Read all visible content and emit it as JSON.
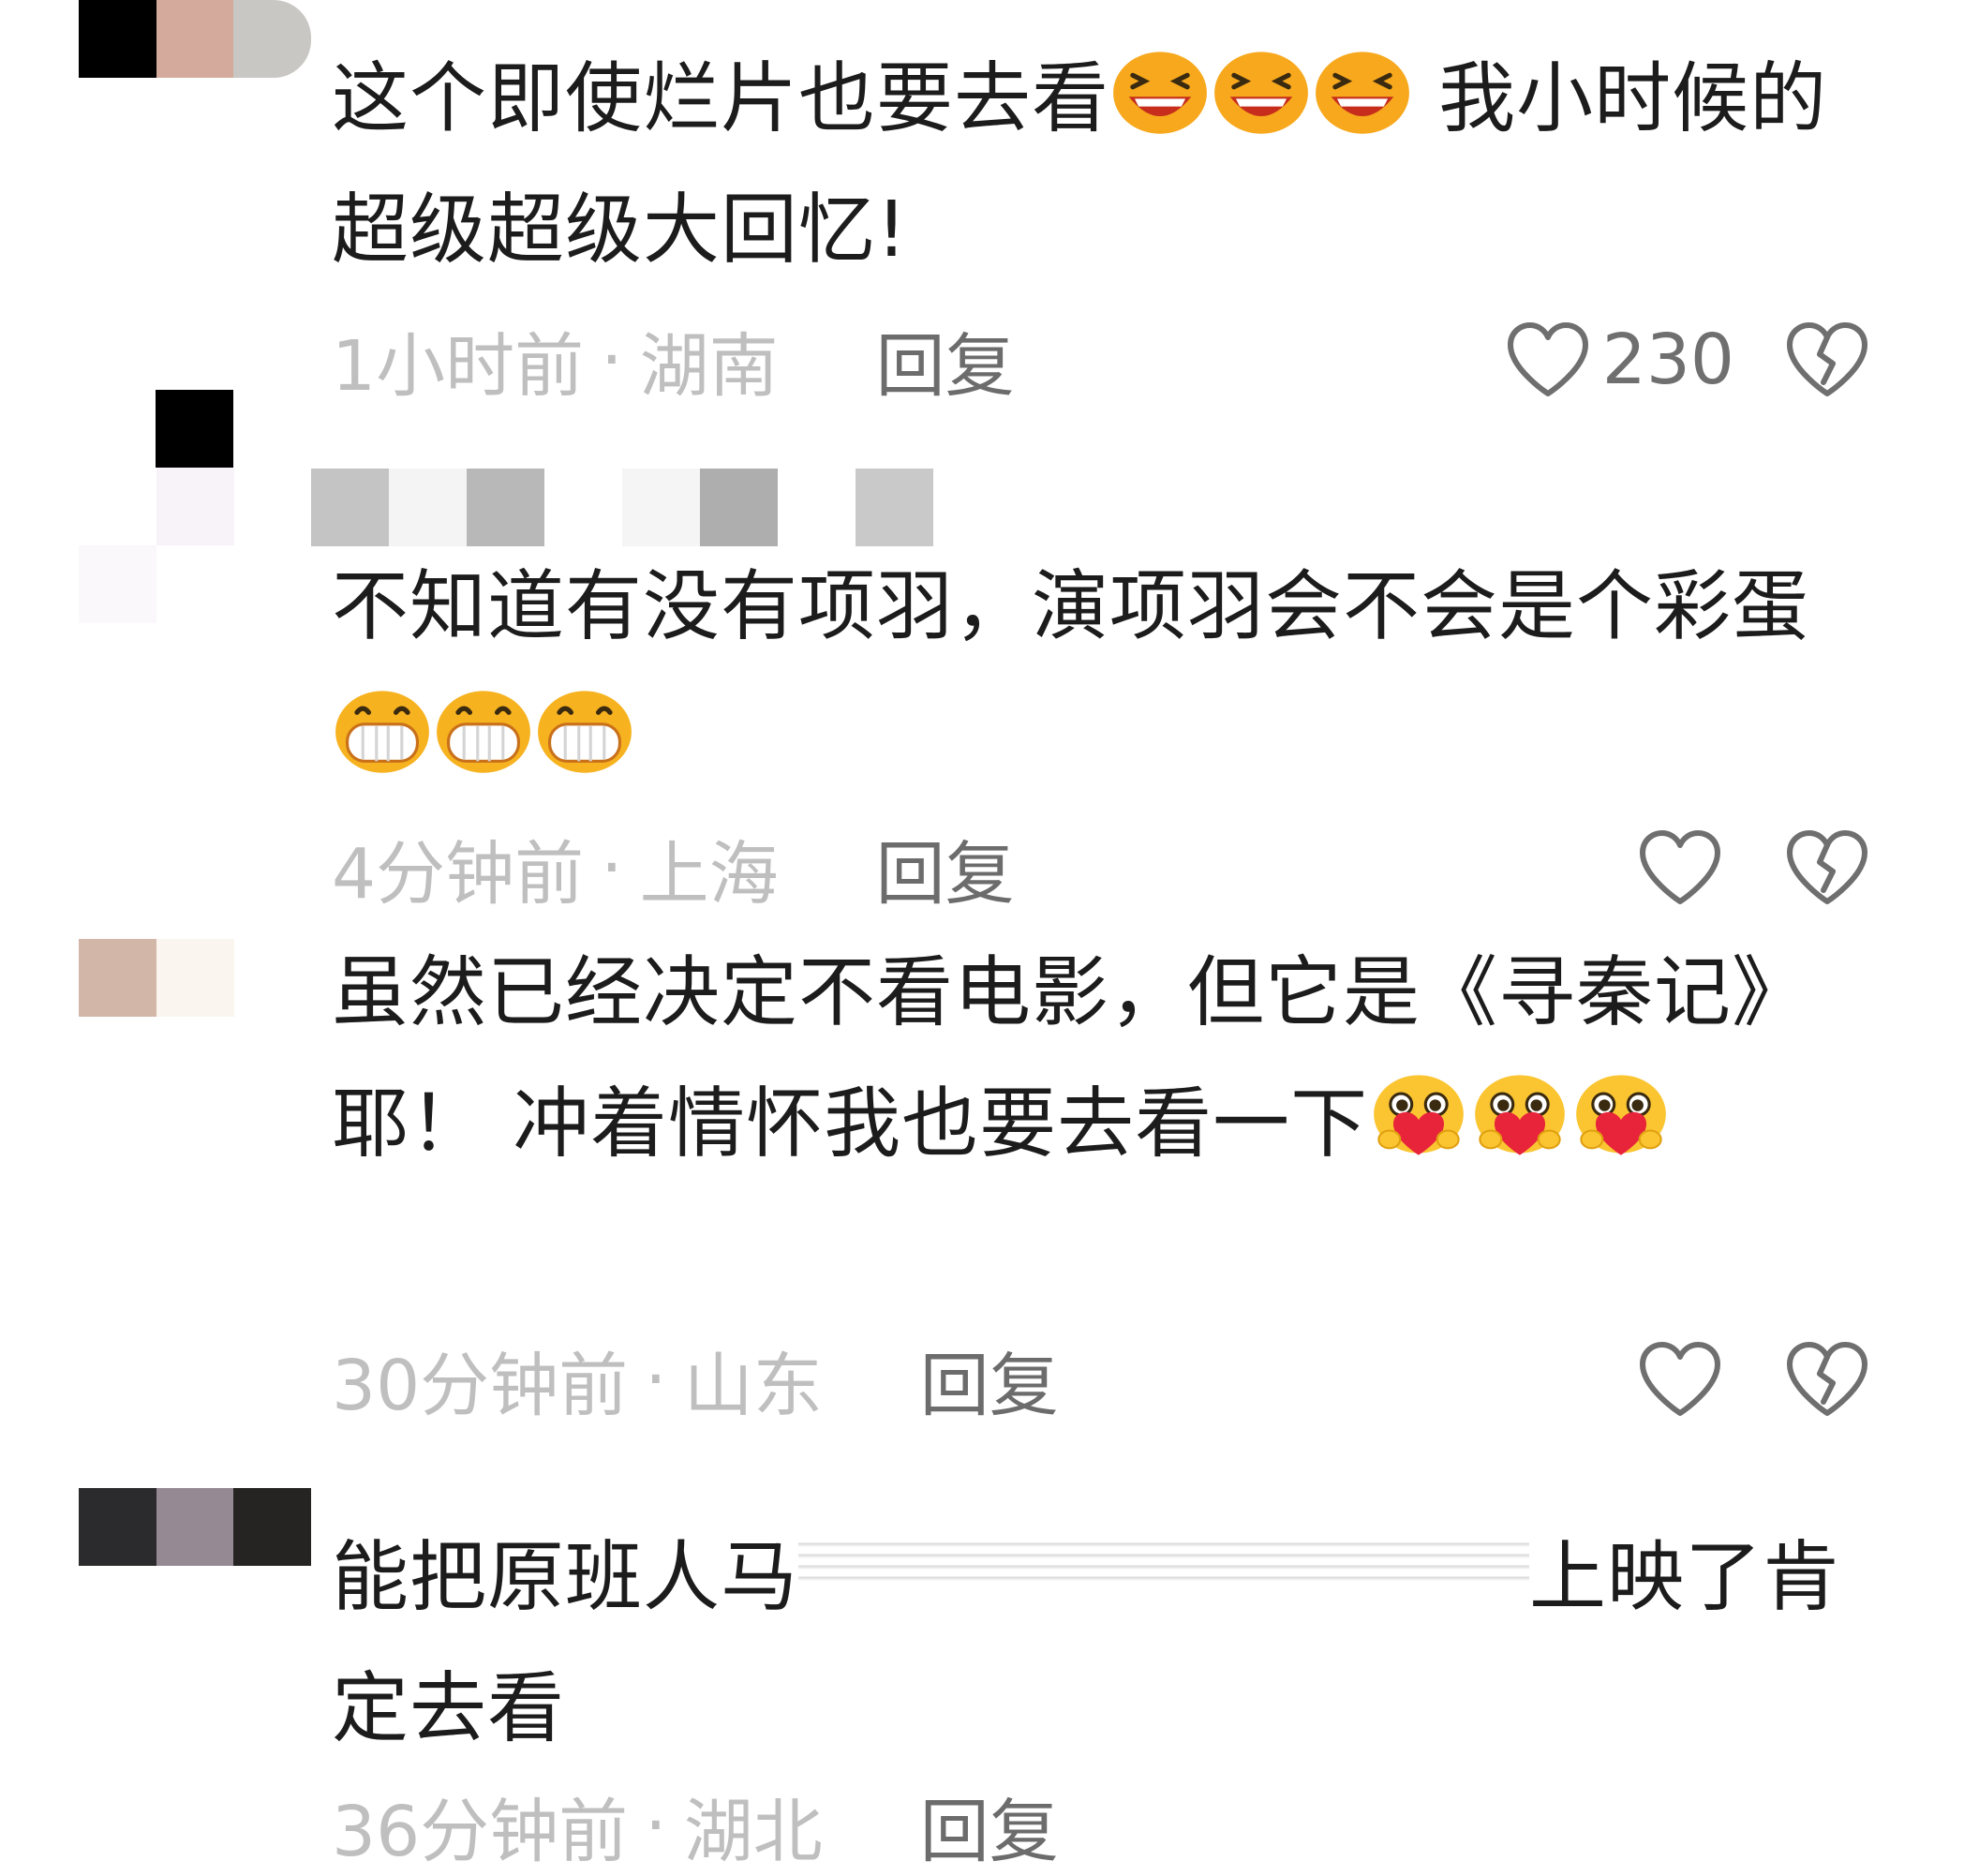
{
  "comments": [
    {
      "text_a": "这个即使烂片也要去看",
      "emoji_a": "laughing-face",
      "text_b": " 我小时候的超级超级大回忆!",
      "time": "1小时前",
      "location": "湖南",
      "reply_label": "回复",
      "likes": "230"
    },
    {
      "text_a": "不知道有没有项羽，演项羽会不会是个彩蛋",
      "emoji_a": "grinning-teeth-face",
      "time": "4分钟前",
      "location": "上海",
      "reply_label": "回复",
      "likes": ""
    },
    {
      "text_a": "虽然已经决定不看电影，但它是《寻秦记》耶！   冲着情怀我也要去看一下",
      "emoji_a": "heart-hug-face",
      "time": "30分钟前",
      "location": "山东",
      "reply_label": "回复",
      "likes": ""
    },
    {
      "text_a": "能把原班人马",
      "text_b": "上映了肯定去看",
      "time": "36分钟前",
      "location": "湖北",
      "reply_label": "回复"
    }
  ],
  "separator": "·",
  "icons": {
    "like": "heart-outline-icon",
    "dislike": "broken-heart-icon"
  },
  "colors": {
    "meta_gray": "#bfbfbf",
    "reply_gray": "#6c6c6c",
    "text": "#1c1c1c"
  }
}
